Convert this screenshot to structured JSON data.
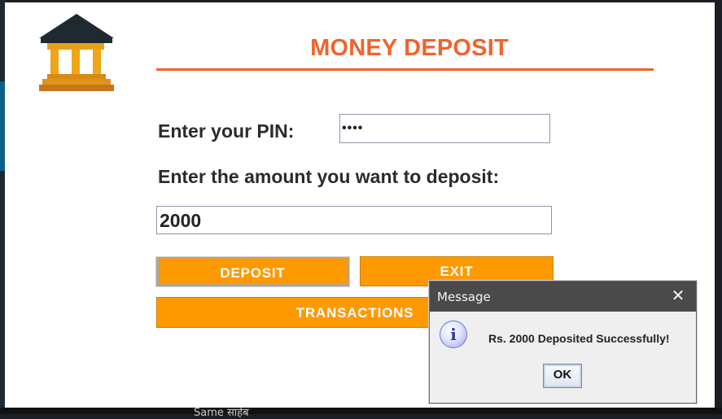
{
  "window": {
    "title": "MONEY DEPOSIT"
  },
  "form": {
    "pin_label": "Enter your PIN:",
    "pin_value": "••••",
    "amount_label": "Enter the amount you want to deposit:",
    "amount_value": "2000"
  },
  "buttons": {
    "deposit": "DEPOSIT",
    "exit": "EXIT",
    "transactions": "TRANSACTIONS"
  },
  "dialog": {
    "title": "Message",
    "close_glyph": "✕",
    "icon": "info-icon",
    "icon_glyph": "i",
    "message": "Rs. 2000 Deposited Successfully!",
    "ok_label": "OK"
  },
  "background": {
    "partial_text": "Same साहेब"
  },
  "colors": {
    "accent": "#f0642c",
    "button": "#ff9900"
  }
}
